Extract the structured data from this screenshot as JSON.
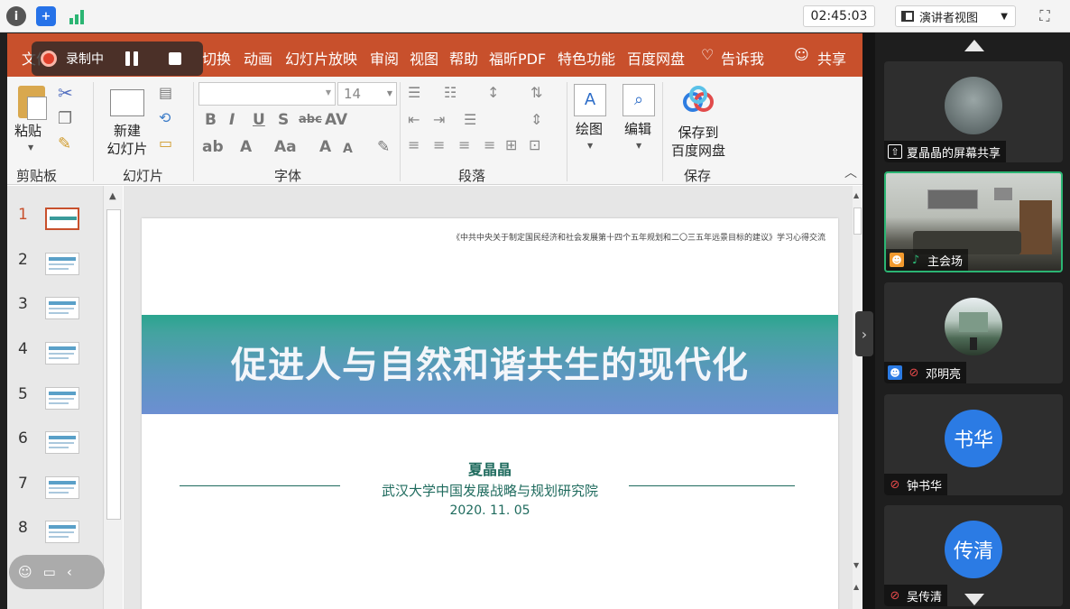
{
  "app": {
    "timer": "02:45:03",
    "view_mode": "演讲者视图"
  },
  "recording": {
    "status": "录制中"
  },
  "menu": {
    "items": [
      "文件",
      "切换",
      "动画",
      "幻灯片放映",
      "审阅",
      "视图",
      "帮助",
      "福昕PDF",
      "特色功能",
      "百度网盘",
      "告诉我",
      "共享"
    ]
  },
  "ribbon": {
    "paste": "粘贴",
    "new_slide": [
      "新建",
      "幻灯片"
    ],
    "font_size": "14",
    "draw": "绘图",
    "edit": "编辑",
    "save_baidu": [
      "保存到",
      "百度网盘"
    ],
    "groups": [
      "剪贴板",
      "幻灯片",
      "字体",
      "段落",
      "保存"
    ]
  },
  "thumbnails": [
    "1",
    "2",
    "3",
    "4",
    "5",
    "6",
    "7",
    "8"
  ],
  "slide": {
    "header": "《中共中央关于制定国民经济和社会发展第十四个五年规划和二〇三五年远景目标的建议》学习心得交流",
    "title": "促进人与自然和谐共生的现代化",
    "author": "夏晶晶",
    "org": "武汉大学中国发展战略与规划研究院",
    "date": "2020. 11. 05"
  },
  "participants": [
    {
      "name": "夏晶晶的屏幕共享",
      "type": "screen-share"
    },
    {
      "name": "主会场",
      "type": "video"
    },
    {
      "name": "邓明亮",
      "type": "photo"
    },
    {
      "name": "钟书华",
      "avatar_text": "书华",
      "type": "avatar"
    },
    {
      "name": "吴传清",
      "avatar_text": "传清",
      "type": "avatar"
    }
  ],
  "colors": {
    "accent": "#c8502c",
    "active_speaker": "#2bb573",
    "avatar_blue": "#2b7be4"
  }
}
